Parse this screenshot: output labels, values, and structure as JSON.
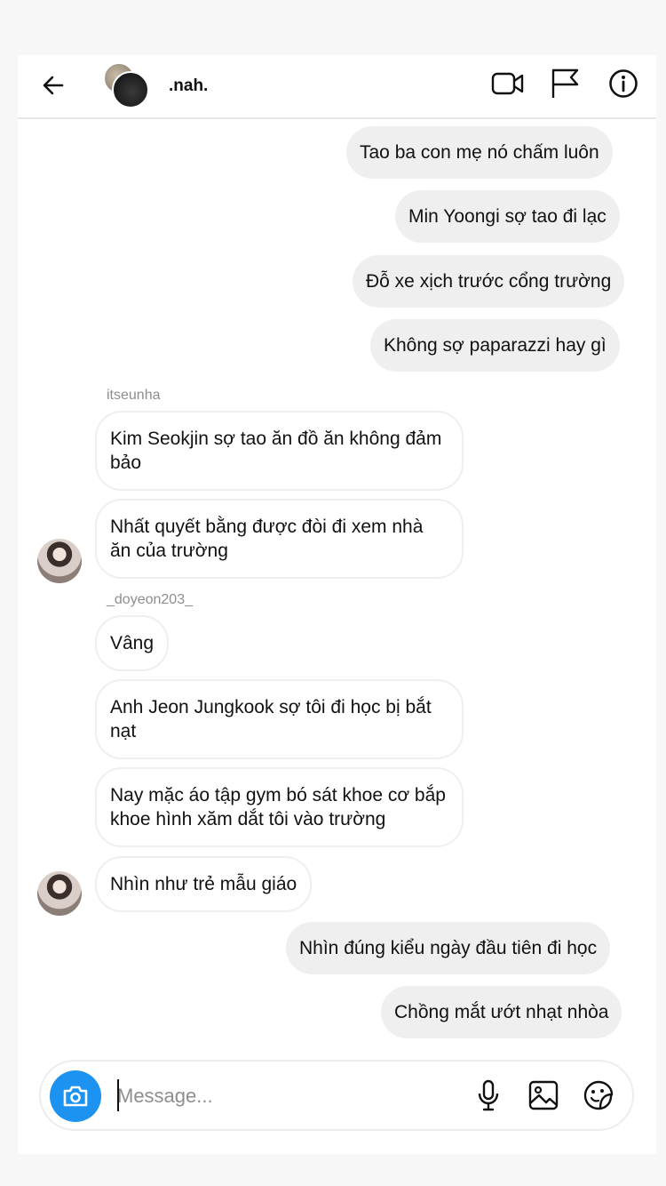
{
  "header": {
    "username": ".nah.",
    "icons": [
      "back-arrow-icon",
      "video-call-icon",
      "flag-icon",
      "info-icon"
    ]
  },
  "messages": {
    "m1": "Tao ba con mẹ nó chấm luôn",
    "m2": "Min Yoongi sợ tao đi lạc",
    "m3": "Đỗ xe xịch trước cổng trường",
    "m4": "Không sợ paparazzi hay gì",
    "sender1": "itseunha",
    "m5": "Kim Seokjin sợ tao ăn đồ ăn không đảm bảo",
    "m6": "Nhất quyết bằng được đòi đi xem nhà ăn của trường",
    "sender2": "_doyeon203_",
    "m7": "Vâng",
    "m8": "Anh Jeon Jungkook sợ tôi đi học bị bắt nạt",
    "m9": "Nay mặc áo tập gym bó sát khoe cơ bắp khoe hình xăm dắt tôi vào trường",
    "m10": "Nhìn như trẻ mẫu giáo",
    "m11": "Nhìn đúng kiểu ngày đầu tiên đi học",
    "m12": "Chồng mắt ướt nhạt nhòa"
  },
  "composer": {
    "placeholder": "Message...",
    "value": "",
    "icons": [
      "camera-icon",
      "microphone-icon",
      "gallery-icon",
      "sticker-icon"
    ]
  },
  "colors": {
    "accent": "#1c92f1",
    "sent_bubble": "#efefef",
    "recv_border": "#efefef",
    "secondary_text": "#8e8e8e"
  }
}
